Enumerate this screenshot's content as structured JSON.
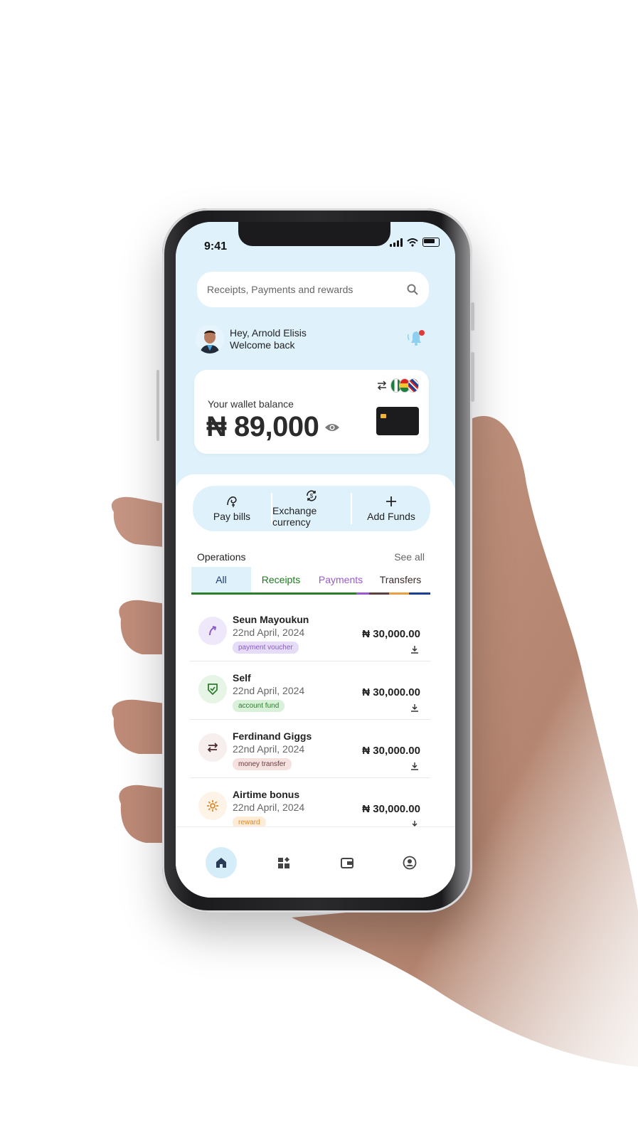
{
  "status_bar": {
    "time": "9:41"
  },
  "search": {
    "placeholder": "Receipts, Payments and rewards"
  },
  "greeting": {
    "line1": "Hey, Arnold Elisis",
    "line2": "Welcome back"
  },
  "wallet": {
    "label": "Your wallet balance",
    "amount": "₦ 89,000"
  },
  "quick_actions": [
    {
      "label": "Pay bills",
      "icon": "pay-bills-icon"
    },
    {
      "label": "Exchange currency",
      "icon": "exchange-currency-icon"
    },
    {
      "label": "Add Funds",
      "icon": "plus-icon"
    }
  ],
  "operations": {
    "title": "Operations",
    "see_all": "See all",
    "tabs": [
      {
        "label": "All",
        "color": "#1d3a75"
      },
      {
        "label": "Receipts",
        "color": "#1e7a1e"
      },
      {
        "label": "Payments",
        "color": "#9b59d0"
      },
      {
        "label": "Transfers",
        "color": "#3b2b2b"
      }
    ]
  },
  "transactions": [
    {
      "name": "Seun Mayoukun",
      "date": "22nd April, 2024",
      "badge": "payment voucher",
      "amount": "₦ 30,000.00",
      "icon": "arrow-up-right-icon",
      "badge_bg": "#e7dcf7",
      "badge_fg": "#8a5cc9",
      "icon_bg": "#efe8fb",
      "icon_fg": "#8a5cc9"
    },
    {
      "name": "Self",
      "date": "22nd April, 2024",
      "badge": "account fund",
      "amount": "₦ 30,000.00",
      "icon": "shield-check-icon",
      "badge_bg": "#d8f1d8",
      "badge_fg": "#2e7d2e",
      "icon_bg": "#e6f5e6",
      "icon_fg": "#2e7d2e"
    },
    {
      "name": "Ferdinand Giggs",
      "date": "22nd April, 2024",
      "badge": "money transfer",
      "amount": "₦ 30,000.00",
      "icon": "transfer-arrows-icon",
      "badge_bg": "#f6e1e1",
      "badge_fg": "#6b3b3b",
      "icon_bg": "#f7eeee",
      "icon_fg": "#4a2b2b"
    },
    {
      "name": "Airtime bonus",
      "date": "22nd April, 2024",
      "badge": "reward",
      "amount": "₦ 30,000.00",
      "icon": "gear-icon",
      "badge_bg": "#fcecd8",
      "badge_fg": "#e08a2c",
      "icon_bg": "#fdf3e6",
      "icon_fg": "#e08a2c"
    }
  ],
  "fab": {
    "label": "+"
  },
  "bottom_nav": [
    {
      "icon": "home-icon",
      "active": true
    },
    {
      "icon": "apps-icon",
      "active": false
    },
    {
      "icon": "wallet-icon",
      "active": false
    },
    {
      "icon": "profile-icon",
      "active": false
    }
  ],
  "colors": {
    "accent": "#49b8ea",
    "light_blue": "#dff2fb"
  }
}
